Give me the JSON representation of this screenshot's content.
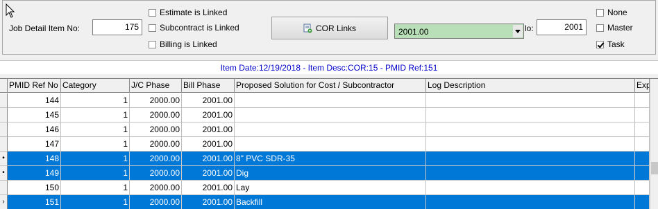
{
  "top": {
    "job_detail_label": "Job Detail Item No:",
    "job_detail_value": "175",
    "estimate_linked": "Estimate is Linked",
    "subcontract_linked": "Subcontract is Linked",
    "billing_linked": "Billing is Linked",
    "cor_links_label": "COR Links",
    "phase_value": "2001.00",
    "no_label": "lo:",
    "no_value": "2001",
    "radio_none": "None",
    "radio_master": "Master",
    "radio_task": "Task",
    "task_checked": true
  },
  "info_bar": "Item Date:12/19/2018 - Item Desc:COR:15 - PMID Ref:151",
  "grid": {
    "headers": {
      "pmid": "PMID Ref No",
      "category": "Category",
      "jc_phase": "J/C Phase",
      "bill_phase": "Bill Phase",
      "solution": "Proposed Solution for Cost / Subcontractor",
      "log": "Log Description",
      "ex": "Exp"
    },
    "rows": [
      {
        "pmid": "144",
        "category": "1",
        "jc_phase": "2000.00",
        "bill_phase": "2001.00",
        "solution": "",
        "indicator": "",
        "selected": false
      },
      {
        "pmid": "145",
        "category": "1",
        "jc_phase": "2000.00",
        "bill_phase": "2001.00",
        "solution": "",
        "indicator": "",
        "selected": false
      },
      {
        "pmid": "146",
        "category": "1",
        "jc_phase": "2000.00",
        "bill_phase": "2001.00",
        "solution": "",
        "indicator": "",
        "selected": false
      },
      {
        "pmid": "147",
        "category": "1",
        "jc_phase": "2000.00",
        "bill_phase": "2001.00",
        "solution": "",
        "indicator": "",
        "selected": false
      },
      {
        "pmid": "148",
        "category": "1",
        "jc_phase": "2000.00",
        "bill_phase": "2001.00",
        "solution": "8\" PVC SDR-35",
        "indicator": "•",
        "selected": true
      },
      {
        "pmid": "149",
        "category": "1",
        "jc_phase": "2000.00",
        "bill_phase": "2001.00",
        "solution": "Dig",
        "indicator": "•",
        "selected": true
      },
      {
        "pmid": "150",
        "category": "1",
        "jc_phase": "2000.00",
        "bill_phase": "2001.00",
        "solution": "Lay",
        "indicator": "",
        "selected": false
      },
      {
        "pmid": "151",
        "category": "1",
        "jc_phase": "2000.00",
        "bill_phase": "2001.00",
        "solution": "Backfill",
        "indicator": "›",
        "selected": true
      }
    ]
  }
}
